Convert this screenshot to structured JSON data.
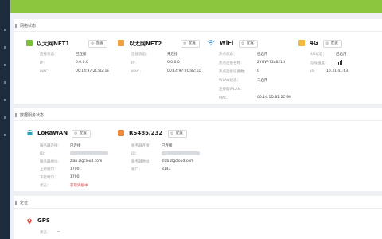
{
  "network": {
    "section_title": "网络状态",
    "config_label": "配置",
    "eth1": {
      "title": "以太网NET1",
      "status_label": "连接状态：",
      "status": "已连接",
      "ip_label": "IP：",
      "ip": "0.0.0.0",
      "mac_label": "MAC：",
      "mac": "00:14:97:2C:82:1E"
    },
    "eth2": {
      "title": "以太网NET2",
      "status_label": "连接状态：",
      "status": "未连接",
      "ip_label": "IP：",
      "ip": "0.0.0.0",
      "mac_label": "MAC：",
      "mac": "00:14:97:2C:82:1D"
    },
    "wifi": {
      "title": "WiFi",
      "hotspot_status_label": "热点状态：",
      "hotspot_status": "已启用",
      "hotspot_name_label": "热点连接名称：",
      "hotspot_name": "ZYGW-72c821d",
      "hotspot_count_label": "热点连接设备数：",
      "hotspot_count": "0",
      "wlan_status_label": "WLAN状态：",
      "wlan_status": "未启用",
      "wlan_conn_label": "连接的WLAN：",
      "wlan_conn": "--",
      "mac_label": "MAC：",
      "mac": "00:14:1D:82:2C:98"
    },
    "g4": {
      "title": "4G",
      "status_label": "4G状态：",
      "status": "已启用",
      "signal_label": "信号强度：",
      "ip_label": "IP：",
      "ip": "10.31.41.63"
    }
  },
  "data_service": {
    "section_title": "数据服务状态",
    "config_label": "配置",
    "lora": {
      "title": "LoRaWAN",
      "conn_label": "服务器连接：",
      "conn": "已连接",
      "id_label": "ID：",
      "addr_label": "服务器地址：",
      "addr": "zlab.zlgcloud.com",
      "up_port_label": "上行端口：",
      "up_port": "1700",
      "down_port_label": "下行端口：",
      "down_port": "1700",
      "status_label": "状态：",
      "status": "获取凭据中"
    },
    "rs485": {
      "title": "RS485/232",
      "conn_label": "服务器连接：",
      "conn": "已连接",
      "id_label": "ID：",
      "addr_label": "服务器地址：",
      "addr": "zlab.zlgcloud.com",
      "port_label": "端口：",
      "port": "8143"
    }
  },
  "location": {
    "section_title": "定位",
    "gps": {
      "title": "GPS",
      "status_label": "状态：",
      "status": "--"
    }
  },
  "colors": {
    "top_bar": "#8cc63f",
    "sidebar": "#1e2d3d",
    "error_text": "#e04a4a"
  }
}
